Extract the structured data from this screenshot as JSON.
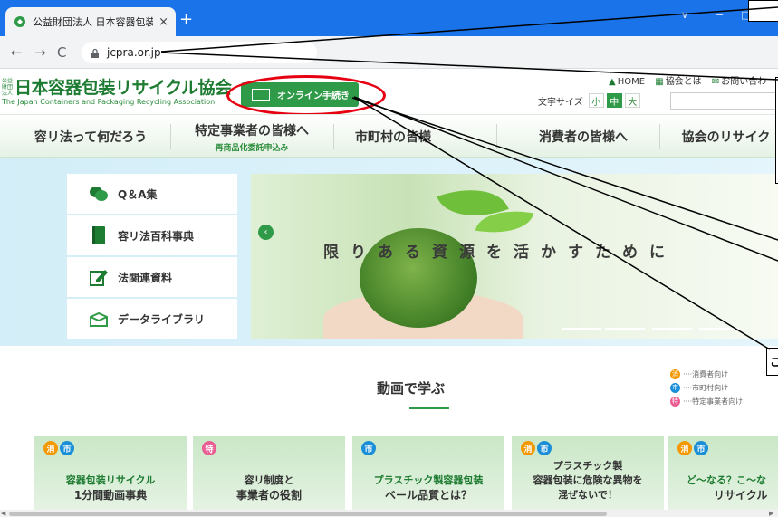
{
  "browser": {
    "tab_title": "公益財団法人 日本容器包装リサイ",
    "tab_close": "×",
    "new_tab": "+",
    "url": "jcpra.or.jp",
    "win_min": "∨",
    "win_restore": "−",
    "win_max": "□"
  },
  "header": {
    "logo_small": "公益財団法人",
    "logo_main": "日本容器包装リサイクル協会",
    "logo_en": "The Japan Containers and Packaging Recycling Association",
    "online_button": "オンライン手続き",
    "home_link": "HOME",
    "about_link": "協会とは",
    "contact_link": "お問い合わ",
    "fontsize_label": "文字サイズ",
    "fs_small": "小",
    "fs_mid": "中",
    "fs_large": "大"
  },
  "nav": {
    "items": [
      {
        "label": "容リ法って何だろう",
        "sub": ""
      },
      {
        "label": "特定事業者の皆様へ",
        "sub": "再商品化委託申込み"
      },
      {
        "label": "市町村の皆様",
        "sub": ""
      },
      {
        "label": "消費者の皆様へ",
        "sub": ""
      },
      {
        "label": "協会のリサイク",
        "sub": ""
      }
    ]
  },
  "side_menu": [
    {
      "label": "Q＆A集",
      "icon": "chat-bubbles-icon"
    },
    {
      "label": "容リ法百科事典",
      "icon": "book-icon"
    },
    {
      "label": "法関連資料",
      "icon": "pen-document-icon"
    },
    {
      "label": "データライブラリ",
      "icon": "open-box-icon"
    }
  ],
  "banner": {
    "text": "限りある資源を活かすために",
    "prev_arrow": "‹"
  },
  "videos": {
    "title": "動画で学ぶ",
    "legend": [
      {
        "badge": "消",
        "label": "····消費者向け",
        "color": "#f39800"
      },
      {
        "badge": "市",
        "label": "····市町村向け",
        "color": "#1a8fd8"
      },
      {
        "badge": "特",
        "label": "····特定事業者向け",
        "color": "#e95d93"
      }
    ],
    "cards": [
      {
        "badges": [
          "消",
          "市"
        ],
        "line1": "容器包装リサイクル",
        "line2": "1分間動画事典"
      },
      {
        "badges": [
          "特"
        ],
        "line1": "容リ制度と",
        "line2": "事業者の役割"
      },
      {
        "badges": [
          "市"
        ],
        "line1": "プラスチック製容器包装",
        "line2": "ベール品質とは？"
      },
      {
        "badges": [
          "消",
          "市"
        ],
        "line1": "プラスチック製",
        "line2": "容器包装に危険な異物を",
        "line3": "混ぜないで！"
      },
      {
        "badges": [
          "消",
          "市"
        ],
        "line1": "ど〜なる？こ〜な",
        "line2": "リサイクル"
      }
    ]
  },
  "callout": {
    "partial_text": "こ"
  }
}
